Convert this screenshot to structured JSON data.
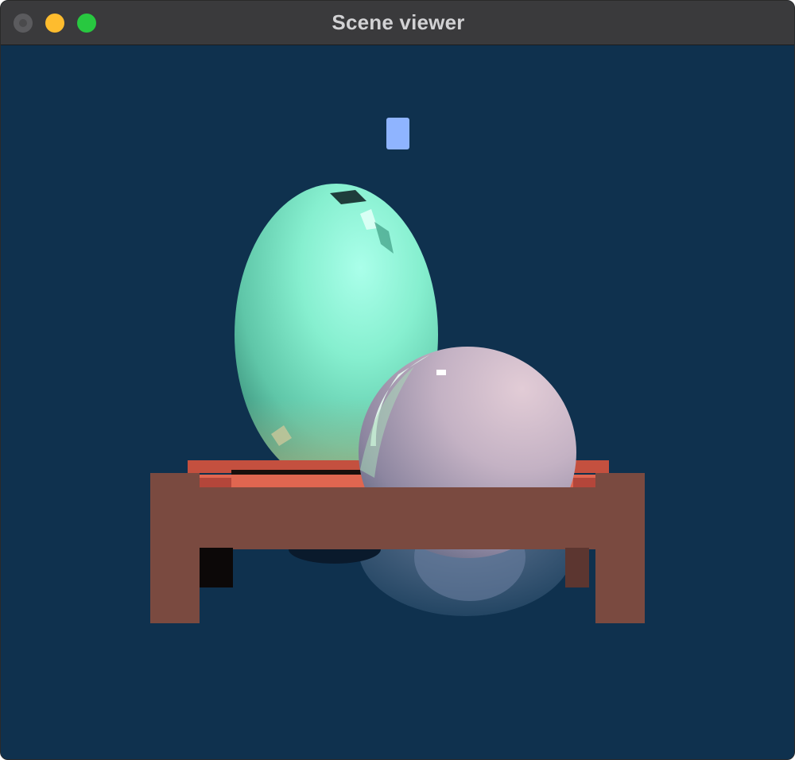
{
  "window": {
    "title": "Scene viewer"
  },
  "icons": {
    "close": "close-traffic-light-icon",
    "minimize": "minimize-traffic-light-icon",
    "zoom": "zoom-traffic-light-icon"
  },
  "colors": {
    "titlebar": "#3a3a3c",
    "background": "#0f314e",
    "light_close": "#5b5b5e",
    "light_minimize": "#febc2e",
    "light_zoom": "#28c840",
    "egg": "#7ee8c8",
    "sphere": "#c8b4c6",
    "table": "#7a4a40",
    "table_top": "#e26250",
    "light_source": "#8fb4ff"
  }
}
